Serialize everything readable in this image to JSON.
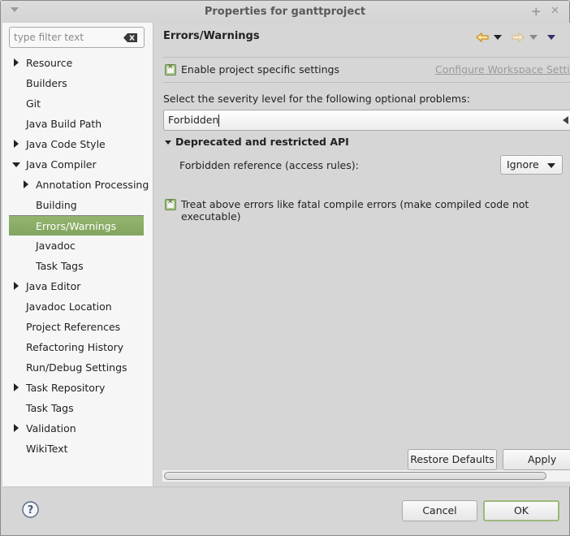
{
  "window": {
    "title": "Properties for ganttproject",
    "maximize_glyph": "+",
    "close_glyph": "✕"
  },
  "sidebar": {
    "filter_placeholder": "type filter text",
    "filter_value": "",
    "items": [
      {
        "label": "Resource",
        "level": 0,
        "expander": "collapsed"
      },
      {
        "label": "Builders",
        "level": 0,
        "expander": "none"
      },
      {
        "label": "Git",
        "level": 0,
        "expander": "none"
      },
      {
        "label": "Java Build Path",
        "level": 0,
        "expander": "none"
      },
      {
        "label": "Java Code Style",
        "level": 0,
        "expander": "collapsed"
      },
      {
        "label": "Java Compiler",
        "level": 0,
        "expander": "expanded"
      },
      {
        "label": "Annotation Processing",
        "level": 1,
        "expander": "collapsed"
      },
      {
        "label": "Building",
        "level": 1,
        "expander": "none"
      },
      {
        "label": "Errors/Warnings",
        "level": 1,
        "expander": "none",
        "selected": true
      },
      {
        "label": "Javadoc",
        "level": 1,
        "expander": "none"
      },
      {
        "label": "Task Tags",
        "level": 1,
        "expander": "none"
      },
      {
        "label": "Java Editor",
        "level": 0,
        "expander": "collapsed"
      },
      {
        "label": "Javadoc Location",
        "level": 0,
        "expander": "none"
      },
      {
        "label": "Project References",
        "level": 0,
        "expander": "none"
      },
      {
        "label": "Refactoring History",
        "level": 0,
        "expander": "none"
      },
      {
        "label": "Run/Debug Settings",
        "level": 0,
        "expander": "none"
      },
      {
        "label": "Task Repository",
        "level": 0,
        "expander": "collapsed"
      },
      {
        "label": "Task Tags",
        "level": 0,
        "expander": "none"
      },
      {
        "label": "Validation",
        "level": 0,
        "expander": "collapsed"
      },
      {
        "label": "WikiText",
        "level": 0,
        "expander": "none"
      }
    ]
  },
  "main": {
    "title": "Errors/Warnings",
    "nav": {
      "back_icon": "back-arrow-icon",
      "forward_icon": "forward-arrow-icon",
      "back_color": "#e0a020",
      "forward_color": "#e8d0a0"
    },
    "enable_project_settings": {
      "label": "Enable project specific settings",
      "checked": true
    },
    "configure_link": "Configure Workspace Settings...",
    "severity_prompt": "Select the severity level for the following optional problems:",
    "filter_value": "Forbidden",
    "section": {
      "title": "Deprecated and restricted API",
      "expanded": true,
      "options": [
        {
          "label": "Forbidden reference (access rules):",
          "value": "Ignore"
        }
      ]
    },
    "treat_fatal": {
      "label": "Treat above errors like fatal compile errors (make compiled code not executable)",
      "checked": true
    },
    "restore_defaults_label": "Restore Defaults",
    "apply_label": "Apply"
  },
  "footer": {
    "cancel_label": "Cancel",
    "ok_label": "OK"
  },
  "colors": {
    "selection": "#8aab65",
    "checkbox": "#a8c48a",
    "ok_border": "#9cb87c"
  }
}
